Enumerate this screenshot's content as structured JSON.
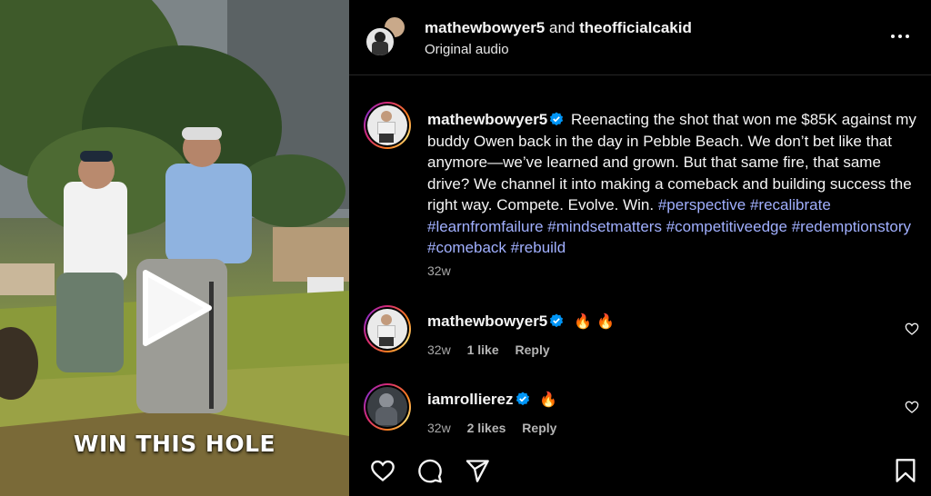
{
  "video": {
    "caption": "WIN THIS HOLE"
  },
  "header": {
    "user1": "mathewbowyer5",
    "connector": "and",
    "user2": "theofficialcakid",
    "audio": "Original audio"
  },
  "post": {
    "username": "mathewbowyer5",
    "text": "Reenacting the shot that won me $85K against my buddy Owen back in the day in Pebble Beach. We don’t bet like that anymore—we’ve learned and grown. But that same fire, that same drive? We channel it into making a comeback and building success the right way. Compete. Evolve. Win.",
    "hashtags": [
      "#perspective",
      "#recalibrate",
      "#learnfromfailure",
      "#mindsetmatters",
      "#competitiveedge",
      "#redemptionstory",
      "#comeback",
      "#rebuild"
    ],
    "time": "32w"
  },
  "comments": [
    {
      "username": "mathewbowyer5",
      "emoji": "🔥 🔥",
      "time": "32w",
      "likes": "1 like",
      "reply": "Reply"
    },
    {
      "username": "iamrollierez",
      "emoji": "🔥",
      "time": "32w",
      "likes": "2 likes",
      "reply": "Reply"
    }
  ],
  "icons": {
    "like": "heart-icon",
    "comment": "comment-icon",
    "share": "send-icon",
    "save": "bookmark-icon",
    "more": "more-options-icon",
    "verified": "verified-badge-icon",
    "play": "play-icon"
  },
  "colors": {
    "background": "#000000",
    "hashtag": "#a1b0ff",
    "verified": "#0095f6",
    "muted_text": "#a8a8a8"
  }
}
